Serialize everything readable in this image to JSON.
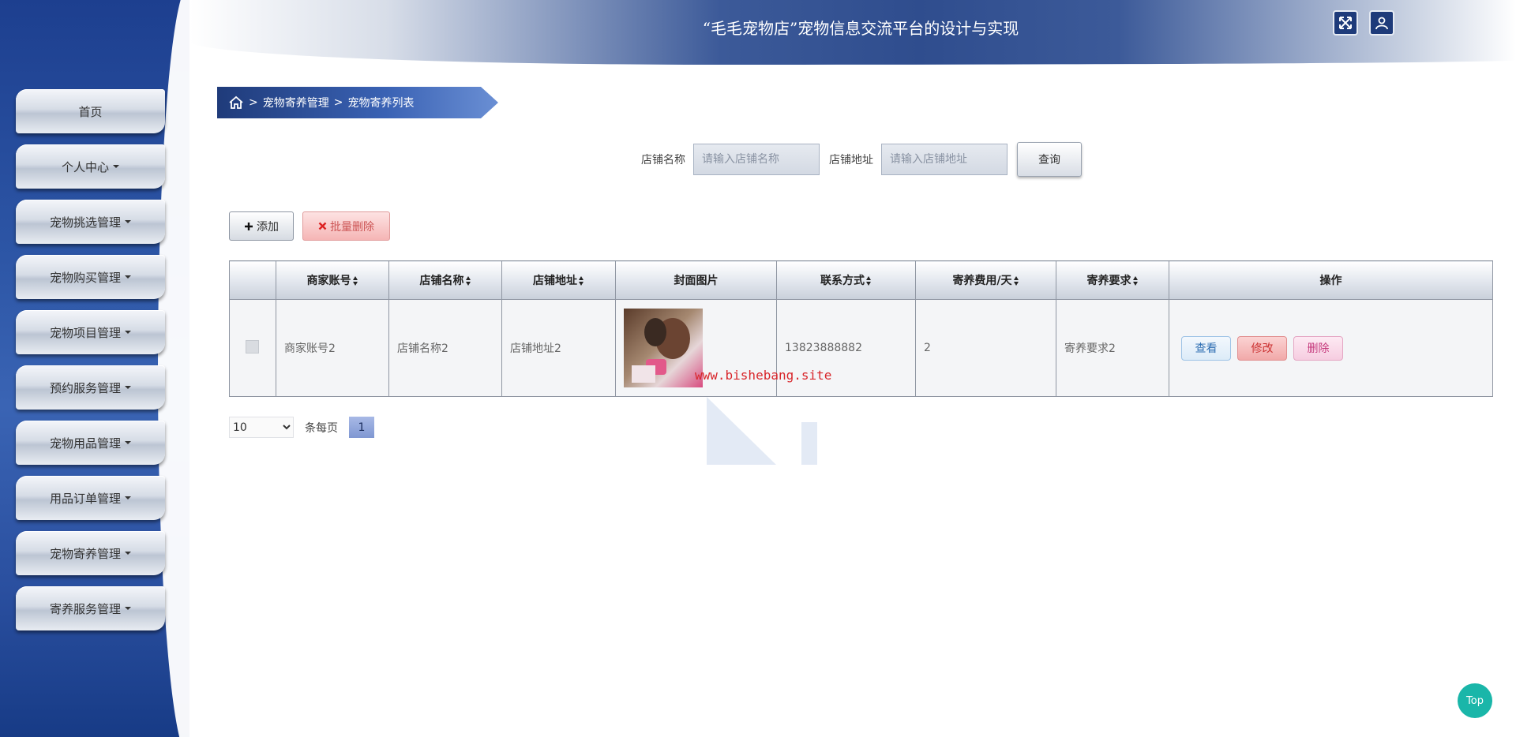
{
  "header": {
    "title": "“毛毛宠物店”宠物信息交流平台的设计与实现",
    "fullscreen_icon": "fullscreen-icon",
    "user_icon": "user-icon"
  },
  "sidebar": {
    "items": [
      {
        "label": "首页",
        "has_dropdown": false
      },
      {
        "label": "个人中心",
        "has_dropdown": true
      },
      {
        "label": "宠物挑选管理",
        "has_dropdown": true
      },
      {
        "label": "宠物购买管理",
        "has_dropdown": true
      },
      {
        "label": "宠物项目管理",
        "has_dropdown": true
      },
      {
        "label": "预约服务管理",
        "has_dropdown": true
      },
      {
        "label": "宠物用品管理",
        "has_dropdown": true
      },
      {
        "label": "用品订单管理",
        "has_dropdown": true
      },
      {
        "label": "宠物寄养管理",
        "has_dropdown": true
      },
      {
        "label": "寄养服务管理",
        "has_dropdown": true
      }
    ]
  },
  "breadcrumb": {
    "home_icon": "home-icon",
    "sep": ">",
    "level1": "宠物寄养管理",
    "level2": "宠物寄养列表"
  },
  "search": {
    "shop_name_label": "店铺名称",
    "shop_name_placeholder": "请输入店铺名称",
    "shop_name_value": "",
    "shop_address_label": "店铺地址",
    "shop_address_placeholder": "请输入店铺地址",
    "shop_address_value": "",
    "submit_label": "查询"
  },
  "actions": {
    "add_label": "添加",
    "batch_delete_label": "批量删除"
  },
  "table": {
    "headers": [
      "商家账号",
      "店铺名称",
      "店铺地址",
      "封面图片",
      "联系方式",
      "寄养费用/天",
      "寄养要求",
      "操作"
    ],
    "rows": [
      {
        "merchant_account": "商家账号2",
        "shop_name": "店铺名称2",
        "shop_address": "店铺地址2",
        "cover_image": "pet-photo",
        "contact": "13823888882",
        "fee_per_day": "2",
        "requirements": "寄养要求2",
        "ops": {
          "view": "查看",
          "edit": "修改",
          "delete": "删除"
        }
      }
    ]
  },
  "watermark": "www.bishebang.site",
  "pagination": {
    "page_size": "10",
    "page_size_options": [
      "10"
    ],
    "per_page_label": "条每页",
    "current_page": "1"
  },
  "top_button": "Top",
  "colors": {
    "sidebar": "#2d56a6",
    "header": "#2f4d8e",
    "top_button": "#1ab6a9",
    "watermark": "#d8262b"
  }
}
